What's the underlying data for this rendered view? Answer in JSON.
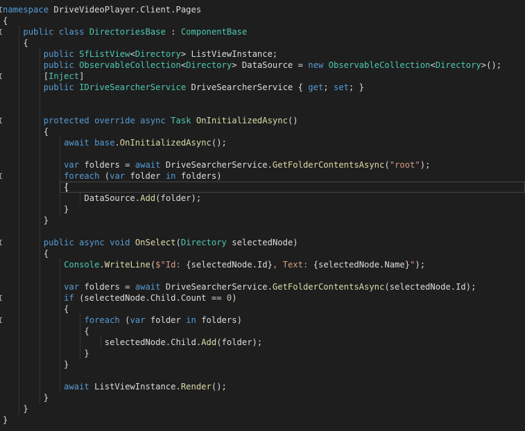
{
  "editor": {
    "language": "csharp",
    "colors": {
      "background": "#1e1e1e",
      "keyword": "#569cd6",
      "type": "#4ec9b0",
      "method": "#dcdcaa",
      "string": "#d69d85",
      "number": "#b5cea8",
      "plain": "#dcdcdc",
      "current_line_border": "#464646"
    },
    "caret": {
      "line": 17
    },
    "lines": [
      {
        "fold": "open",
        "tokens": [
          [
            "kw",
            "namespace"
          ],
          [
            "pl",
            " DriveVideoPlayer.Client.Pages"
          ]
        ]
      },
      {
        "tokens": [
          [
            "pl",
            "{"
          ]
        ]
      },
      {
        "fold": "open",
        "tokens": [
          [
            "pl",
            "    "
          ],
          [
            "kw",
            "public"
          ],
          [
            "pl",
            " "
          ],
          [
            "kw",
            "class"
          ],
          [
            "pl",
            " "
          ],
          [
            "ty",
            "DirectoriesBase"
          ],
          [
            "pl",
            " : "
          ],
          [
            "ty",
            "ComponentBase"
          ]
        ]
      },
      {
        "tokens": [
          [
            "pl",
            "    {"
          ]
        ]
      },
      {
        "tokens": [
          [
            "pl",
            "        "
          ],
          [
            "kw",
            "public"
          ],
          [
            "pl",
            " "
          ],
          [
            "ty",
            "SfListView"
          ],
          [
            "pl",
            "<"
          ],
          [
            "ty",
            "Directory"
          ],
          [
            "pl",
            "> ListViewInstance;"
          ]
        ]
      },
      {
        "tokens": [
          [
            "pl",
            "        "
          ],
          [
            "kw",
            "public"
          ],
          [
            "pl",
            " "
          ],
          [
            "ty",
            "ObservableCollection"
          ],
          [
            "pl",
            "<"
          ],
          [
            "ty",
            "Directory"
          ],
          [
            "pl",
            "> DataSource = "
          ],
          [
            "kw",
            "new"
          ],
          [
            "pl",
            " "
          ],
          [
            "ty",
            "ObservableCollection"
          ],
          [
            "pl",
            "<"
          ],
          [
            "ty",
            "Directory"
          ],
          [
            "pl",
            ">();"
          ]
        ]
      },
      {
        "fold": "open",
        "tokens": [
          [
            "pl",
            "        ["
          ],
          [
            "ty",
            "Inject"
          ],
          [
            "pl",
            "]"
          ]
        ]
      },
      {
        "tokens": [
          [
            "pl",
            "        "
          ],
          [
            "kw",
            "public"
          ],
          [
            "pl",
            " "
          ],
          [
            "ty",
            "IDriveSearcherService"
          ],
          [
            "pl",
            " DriveSearcherService { "
          ],
          [
            "kw",
            "get"
          ],
          [
            "pl",
            "; "
          ],
          [
            "kw",
            "set"
          ],
          [
            "pl",
            "; }"
          ]
        ]
      },
      {
        "tokens": []
      },
      {
        "tokens": []
      },
      {
        "fold": "open",
        "tokens": [
          [
            "pl",
            "        "
          ],
          [
            "kw",
            "protected"
          ],
          [
            "pl",
            " "
          ],
          [
            "kw",
            "override"
          ],
          [
            "pl",
            " "
          ],
          [
            "kw",
            "async"
          ],
          [
            "pl",
            " "
          ],
          [
            "ty",
            "Task"
          ],
          [
            "pl",
            " "
          ],
          [
            "fn",
            "OnInitializedAsync"
          ],
          [
            "pl",
            "()"
          ]
        ]
      },
      {
        "tokens": [
          [
            "pl",
            "        {"
          ]
        ]
      },
      {
        "tokens": [
          [
            "pl",
            "            "
          ],
          [
            "kw",
            "await"
          ],
          [
            "pl",
            " "
          ],
          [
            "kw",
            "base"
          ],
          [
            "pl",
            "."
          ],
          [
            "fn",
            "OnInitializedAsync"
          ],
          [
            "pl",
            "();"
          ]
        ]
      },
      {
        "tokens": []
      },
      {
        "tokens": [
          [
            "pl",
            "            "
          ],
          [
            "kw",
            "var"
          ],
          [
            "pl",
            " folders = "
          ],
          [
            "kw",
            "await"
          ],
          [
            "pl",
            " DriveSearcherService."
          ],
          [
            "fn",
            "GetFolderContentsAsync"
          ],
          [
            "pl",
            "("
          ],
          [
            "st",
            "\"root\""
          ],
          [
            "pl",
            ");"
          ]
        ]
      },
      {
        "fold": "open",
        "tokens": [
          [
            "pl",
            "            "
          ],
          [
            "kw",
            "foreach"
          ],
          [
            "pl",
            " ("
          ],
          [
            "kw",
            "var"
          ],
          [
            "pl",
            " folder "
          ],
          [
            "kw",
            "in"
          ],
          [
            "pl",
            " folders)"
          ]
        ]
      },
      {
        "tokens": [
          [
            "pl",
            "            {"
          ]
        ]
      },
      {
        "tokens": [
          [
            "pl",
            "                DataSource."
          ],
          [
            "fn",
            "Add"
          ],
          [
            "pl",
            "(folder);"
          ]
        ]
      },
      {
        "tokens": [
          [
            "pl",
            "            }"
          ]
        ]
      },
      {
        "tokens": [
          [
            "pl",
            "        }"
          ]
        ]
      },
      {
        "tokens": []
      },
      {
        "fold": "open",
        "tokens": [
          [
            "pl",
            "        "
          ],
          [
            "kw",
            "public"
          ],
          [
            "pl",
            " "
          ],
          [
            "kw",
            "async"
          ],
          [
            "pl",
            " "
          ],
          [
            "kw",
            "void"
          ],
          [
            "pl",
            " "
          ],
          [
            "fn",
            "OnSelect"
          ],
          [
            "pl",
            "("
          ],
          [
            "ty",
            "Directory"
          ],
          [
            "pl",
            " selectedNode)"
          ]
        ]
      },
      {
        "tokens": [
          [
            "pl",
            "        {"
          ]
        ]
      },
      {
        "tokens": [
          [
            "pl",
            "            "
          ],
          [
            "ty",
            "Console"
          ],
          [
            "pl",
            "."
          ],
          [
            "fn",
            "WriteLine"
          ],
          [
            "pl",
            "("
          ],
          [
            "st",
            "$\"Id: "
          ],
          [
            "pl",
            "{selectedNode.Id}"
          ],
          [
            "st",
            ", Text: "
          ],
          [
            "pl",
            "{selectedNode.Name}"
          ],
          [
            "st",
            "\""
          ],
          [
            "pl",
            ");"
          ]
        ]
      },
      {
        "tokens": []
      },
      {
        "tokens": [
          [
            "pl",
            "            "
          ],
          [
            "kw",
            "var"
          ],
          [
            "pl",
            " folders = "
          ],
          [
            "kw",
            "await"
          ],
          [
            "pl",
            " DriveSearcherService."
          ],
          [
            "fn",
            "GetFolderContentsAsync"
          ],
          [
            "pl",
            "(selectedNode.Id);"
          ]
        ]
      },
      {
        "fold": "open",
        "tokens": [
          [
            "pl",
            "            "
          ],
          [
            "kw",
            "if"
          ],
          [
            "pl",
            " (selectedNode.Child.Count == "
          ],
          [
            "nm",
            "0"
          ],
          [
            "pl",
            ")"
          ]
        ]
      },
      {
        "tokens": [
          [
            "pl",
            "            {"
          ]
        ]
      },
      {
        "fold": "open",
        "tokens": [
          [
            "pl",
            "                "
          ],
          [
            "kw",
            "foreach"
          ],
          [
            "pl",
            " ("
          ],
          [
            "kw",
            "var"
          ],
          [
            "pl",
            " folder "
          ],
          [
            "kw",
            "in"
          ],
          [
            "pl",
            " folders)"
          ]
        ]
      },
      {
        "tokens": [
          [
            "pl",
            "                {"
          ]
        ]
      },
      {
        "tokens": [
          [
            "pl",
            "                    selectedNode.Child."
          ],
          [
            "fn",
            "Add"
          ],
          [
            "pl",
            "(folder);"
          ]
        ]
      },
      {
        "tokens": [
          [
            "pl",
            "                }"
          ]
        ]
      },
      {
        "tokens": [
          [
            "pl",
            "            }"
          ]
        ]
      },
      {
        "tokens": []
      },
      {
        "tokens": [
          [
            "pl",
            "            "
          ],
          [
            "kw",
            "await"
          ],
          [
            "pl",
            " ListViewInstance."
          ],
          [
            "fn",
            "Render"
          ],
          [
            "pl",
            "();"
          ]
        ]
      },
      {
        "tokens": [
          [
            "pl",
            "        }"
          ]
        ]
      },
      {
        "tokens": [
          [
            "pl",
            "    }"
          ]
        ]
      },
      {
        "tokens": [
          [
            "pl",
            "}"
          ]
        ]
      }
    ]
  }
}
